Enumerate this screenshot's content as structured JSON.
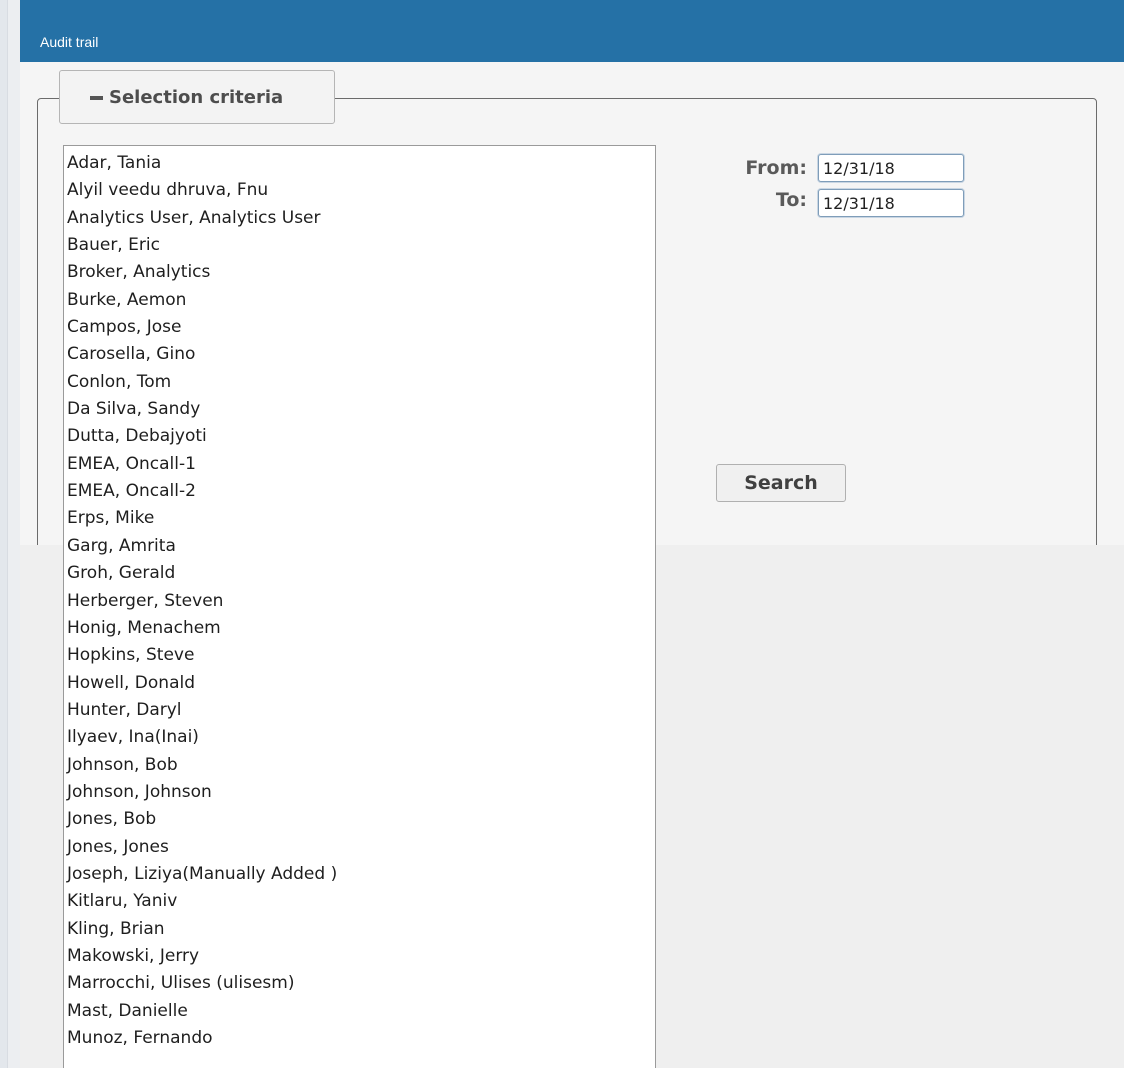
{
  "panel": {
    "title": "Audit trail"
  },
  "selection": {
    "legend": "Selection criteria"
  },
  "dates": {
    "from_label": "From:",
    "from_value": "12/31/18",
    "to_label": "To:",
    "to_value": "12/31/18"
  },
  "search": {
    "label": "Search"
  },
  "users": [
    "Adar, Tania",
    "Alyil veedu dhruva, Fnu",
    "Analytics User, Analytics User",
    "Bauer, Eric",
    "Broker, Analytics",
    "Burke, Aemon",
    "Campos, Jose",
    "Carosella, Gino",
    "Conlon, Tom",
    "Da Silva, Sandy",
    "Dutta, Debajyoti",
    "EMEA, Oncall-1",
    "EMEA, Oncall-2",
    "Erps, Mike",
    "Garg, Amrita",
    "Groh, Gerald",
    "Herberger, Steven",
    "Honig, Menachem",
    "Hopkins, Steve",
    "Howell, Donald",
    "Hunter, Daryl",
    "Ilyaev, Ina(Inai)",
    "Johnson, Bob",
    "Johnson, Johnson",
    "Jones, Bob",
    "Jones, Jones",
    "Joseph, Liziya(Manually Added )",
    "Kitlaru, Yaniv",
    "Kling, Brian",
    "Makowski, Jerry",
    "Marrocchi, Ulises (ulisesm)",
    "Mast, Danielle",
    "Munoz, Fernando"
  ]
}
